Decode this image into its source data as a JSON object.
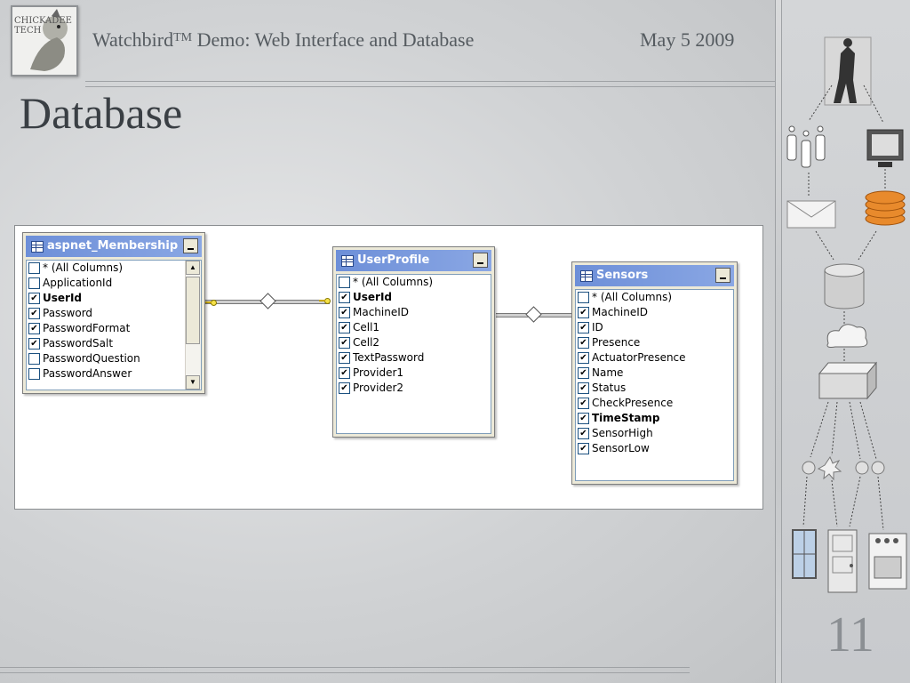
{
  "header": {
    "logo_text": "CHICKADEE TECH",
    "title": "Watchbird",
    "title_mark": "TM",
    "title_rest": " Demo: Web Interface and Database",
    "date": "May 5 2009"
  },
  "page": {
    "heading": "Database",
    "slide_number": "11"
  },
  "diagram": {
    "tables": [
      {
        "name": "aspnet_Membership",
        "columns": [
          {
            "label": "* (All Columns)",
            "checked": false,
            "bold": false
          },
          {
            "label": "ApplicationId",
            "checked": false,
            "bold": false
          },
          {
            "label": "UserId",
            "checked": true,
            "bold": true
          },
          {
            "label": "Password",
            "checked": true,
            "bold": false
          },
          {
            "label": "PasswordFormat",
            "checked": true,
            "bold": false
          },
          {
            "label": "PasswordSalt",
            "checked": true,
            "bold": false
          },
          {
            "label": "PasswordQuestion",
            "checked": false,
            "bold": false
          },
          {
            "label": "PasswordAnswer",
            "checked": false,
            "bold": false
          }
        ]
      },
      {
        "name": "UserProfile",
        "columns": [
          {
            "label": "* (All Columns)",
            "checked": false,
            "bold": false
          },
          {
            "label": "UserId",
            "checked": true,
            "bold": true
          },
          {
            "label": "MachineID",
            "checked": true,
            "bold": false
          },
          {
            "label": "Cell1",
            "checked": true,
            "bold": false
          },
          {
            "label": "Cell2",
            "checked": true,
            "bold": false
          },
          {
            "label": "TextPassword",
            "checked": true,
            "bold": false
          },
          {
            "label": "Provider1",
            "checked": true,
            "bold": false
          },
          {
            "label": "Provider2",
            "checked": true,
            "bold": false
          }
        ]
      },
      {
        "name": "Sensors",
        "columns": [
          {
            "label": "* (All Columns)",
            "checked": false,
            "bold": false
          },
          {
            "label": "MachineID",
            "checked": true,
            "bold": false
          },
          {
            "label": "ID",
            "checked": true,
            "bold": false
          },
          {
            "label": "Presence",
            "checked": true,
            "bold": false
          },
          {
            "label": "ActuatorPresence",
            "checked": true,
            "bold": false
          },
          {
            "label": "Name",
            "checked": true,
            "bold": false
          },
          {
            "label": "Status",
            "checked": true,
            "bold": false
          },
          {
            "label": "CheckPresence",
            "checked": true,
            "bold": false
          },
          {
            "label": "TimeStamp",
            "checked": true,
            "bold": true
          },
          {
            "label": "SensorHigh",
            "checked": true,
            "bold": false
          },
          {
            "label": "SensorLow",
            "checked": true,
            "bold": false
          }
        ]
      }
    ]
  },
  "icons": {
    "sidebar": [
      "person-photo-icon",
      "sensor-tags-icon",
      "computer-monitor-icon",
      "envelope-icon",
      "coin-stack-icon",
      "database-cylinder-icon",
      "cloud-icon",
      "server-box-icon",
      "sensor-nodes-icon",
      "window-icon",
      "door-icon",
      "stove-icon"
    ]
  },
  "colors": {
    "title_bar": "#6d8fd8",
    "slide_text": "#555b60",
    "heading": "#3a3f44"
  }
}
